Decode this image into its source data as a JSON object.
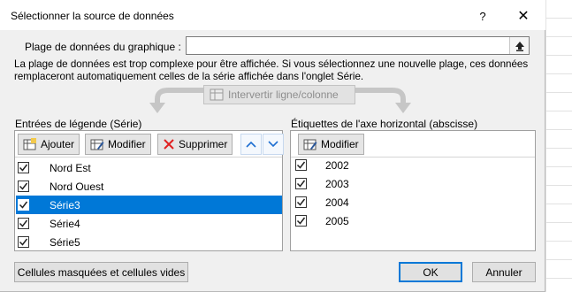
{
  "dialog": {
    "title": "Sélectionner la source de données",
    "help": "?",
    "close": "✕"
  },
  "range": {
    "label": "Plage de données du graphique :",
    "value": ""
  },
  "warning": "La plage de données est trop complexe pour être affichée. Si vous sélectionnez une nouvelle plage, ces données remplaceront automatiquement celles de la série affichée dans l'onglet Série.",
  "switch_label": "Intervertir ligne/colonne",
  "legend": {
    "label": "Entrées de légende (Série)",
    "add": "Ajouter",
    "edit": "Modifier",
    "remove": "Supprimer",
    "items": [
      {
        "label": "Nord Est",
        "checked": true,
        "selected": false
      },
      {
        "label": "Nord Ouest",
        "checked": true,
        "selected": false
      },
      {
        "label": "Série3",
        "checked": true,
        "selected": true
      },
      {
        "label": "Série4",
        "checked": true,
        "selected": false
      },
      {
        "label": "Série5",
        "checked": true,
        "selected": false
      }
    ]
  },
  "axis": {
    "label": "Étiquettes de l'axe horizontal (abscisse)",
    "edit": "Modifier",
    "items": [
      {
        "label": "2002",
        "checked": true
      },
      {
        "label": "2003",
        "checked": true
      },
      {
        "label": "2004",
        "checked": true
      },
      {
        "label": "2005",
        "checked": true
      }
    ]
  },
  "footer": {
    "hidden_cells": "Cellules masquées et cellules vides",
    "ok": "OK",
    "cancel": "Annuler"
  },
  "colors": {
    "selection": "#0078d7",
    "dialog_bg": "#f0f0f0"
  },
  "icons": {
    "collapse": "collapse-range-icon",
    "add": "table-add-icon",
    "edit": "table-edit-icon",
    "remove": "red-x-icon",
    "up": "chevron-up-icon",
    "down": "chevron-down-icon"
  }
}
